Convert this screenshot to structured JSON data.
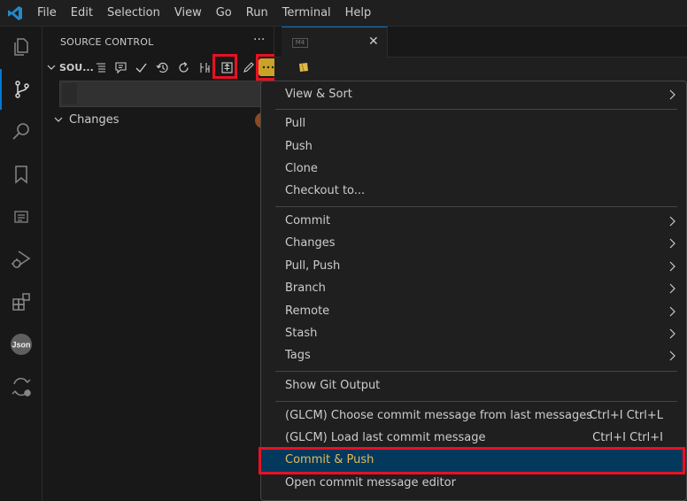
{
  "menubar": {
    "items": [
      "File",
      "Edit",
      "Selection",
      "View",
      "Go",
      "Run",
      "Terminal",
      "Help"
    ]
  },
  "activity_bar": {
    "icons": [
      "explorer-icon",
      "source-control-icon",
      "search-icon",
      "bookmarks-icon",
      "outline-icon",
      "run-debug-icon",
      "extensions-icon",
      "json-icon",
      "git-diff-icon"
    ],
    "json_label": "Json"
  },
  "sidebar": {
    "title": "SOURCE CONTROL",
    "more": "···",
    "section_label": "SOU...",
    "changes_label": "Changes"
  },
  "editor": {
    "tab_icon_text": "M4"
  },
  "context_menu": {
    "items": [
      {
        "label": "View & Sort",
        "submenu": true
      },
      {
        "label": "Pull"
      },
      {
        "label": "Push"
      },
      {
        "label": "Clone"
      },
      {
        "label": "Checkout to..."
      },
      {
        "label": "Commit",
        "submenu": true
      },
      {
        "label": "Changes",
        "submenu": true
      },
      {
        "label": "Pull, Push",
        "submenu": true
      },
      {
        "label": "Branch",
        "submenu": true
      },
      {
        "label": "Remote",
        "submenu": true
      },
      {
        "label": "Stash",
        "submenu": true
      },
      {
        "label": "Tags",
        "submenu": true
      },
      {
        "label": "Show Git Output"
      },
      {
        "label": "(GLCM) Choose commit message from last messages",
        "shortcut": "Ctrl+I Ctrl+L"
      },
      {
        "label": "(GLCM) Load last commit message",
        "shortcut": "Ctrl+I Ctrl+I"
      },
      {
        "label": "Commit & Push",
        "selected": true
      },
      {
        "label": "Open commit message editor"
      }
    ]
  },
  "colors": {
    "accent": "#0078d4",
    "highlight_box": "#e81123",
    "selected_item_bg": "#04395e",
    "selected_item_text": "#e5b95c",
    "more_button": "#c9a227"
  }
}
